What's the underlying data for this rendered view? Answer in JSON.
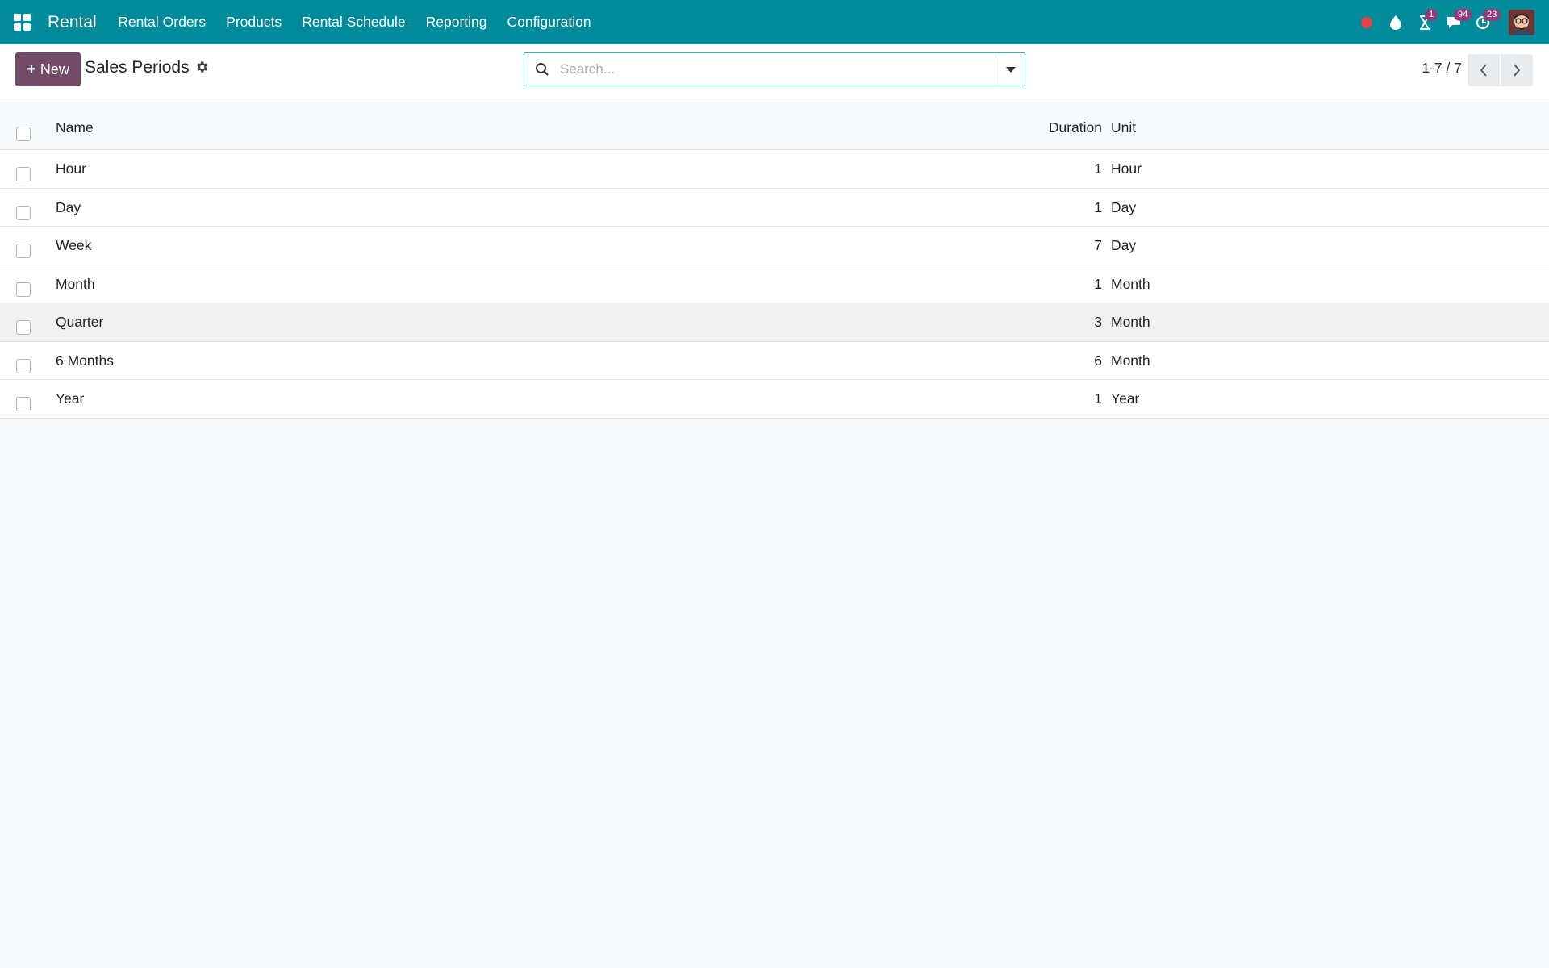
{
  "navbar": {
    "app_name": "Rental",
    "menu": [
      "Rental Orders",
      "Products",
      "Rental Schedule",
      "Reporting",
      "Configuration"
    ],
    "badges": {
      "activities": "1",
      "messages": "94",
      "updates": "23"
    },
    "color": "#018a99"
  },
  "control_panel": {
    "new_label": "New",
    "title": "Sales Periods",
    "search_placeholder": "Search...",
    "pager": "1-7 / 7"
  },
  "table": {
    "columns": {
      "name": "Name",
      "duration": "Duration",
      "unit": "Unit"
    },
    "rows": [
      {
        "name": "Hour",
        "duration": "1",
        "unit": "Hour"
      },
      {
        "name": "Day",
        "duration": "1",
        "unit": "Day"
      },
      {
        "name": "Week",
        "duration": "7",
        "unit": "Day"
      },
      {
        "name": "Month",
        "duration": "1",
        "unit": "Month"
      },
      {
        "name": "Quarter",
        "duration": "3",
        "unit": "Month"
      },
      {
        "name": "6 Months",
        "duration": "6",
        "unit": "Month"
      },
      {
        "name": "Year",
        "duration": "1",
        "unit": "Year"
      }
    ]
  },
  "colors": {
    "primary": "#714b67",
    "navbar": "#018a99",
    "badge": "#8f3e7a",
    "record": "#e3434a"
  }
}
